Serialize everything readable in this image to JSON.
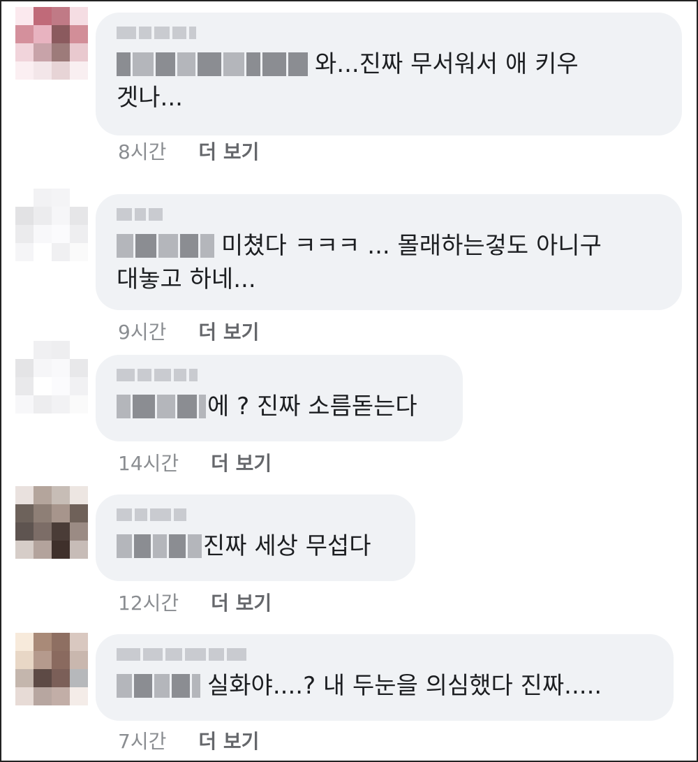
{
  "comments": [
    {
      "line1": "와...진짜 무서워서 애 키우",
      "line2": "겟나...",
      "time": "8시간",
      "more": "더 보기",
      "avatar_colors": [
        "#fbe9ee",
        "#c06a79",
        "#c07a86",
        "#f5dde3",
        "#d4909c",
        "#e8b3c0",
        "#8b5a5e",
        "#d28e98",
        "#f1d4db",
        "#c8a3a9",
        "#9d7b7a",
        "#e9c9cf",
        "#fbeff2",
        "#f3e6e9",
        "#e7d4d6",
        "#f9eff1"
      ]
    },
    {
      "line1": "미쳤다 ㅋㅋㅋ ... 몰래하는겋도 아니구",
      "line2": "대놓고 하네...",
      "time": "9시간",
      "more": "더 보기",
      "avatar_colors": [
        "#ffffff",
        "#f2f2f4",
        "#f4f4f6",
        "#ffffff",
        "#e2e2e4",
        "#ececee",
        "#f6f6f8",
        "#e6e6e8",
        "#ebebed",
        "#f8f8fa",
        "#fbfbfd",
        "#eeeef0",
        "#f5f5f7",
        "#ffffff",
        "#f0f0f2",
        "#fafafa"
      ]
    },
    {
      "line1": "에 ? 진짜 소름돋는다",
      "time": "14시간",
      "more": "더 보기",
      "avatar_colors": [
        "#ffffff",
        "#f0f0f2",
        "#eeeef0",
        "#ffffff",
        "#e4e4e6",
        "#f6f6f8",
        "#f9f9fb",
        "#e8e8ea",
        "#e9e9eb",
        "#ffffff",
        "#fbfbfd",
        "#f1f1f3",
        "#f7f7f9",
        "#ededef",
        "#f2f2f4",
        "#fafafa"
      ]
    },
    {
      "line1": "진짜 세상 무섭다",
      "time": "12시간",
      "more": "더 보기",
      "avatar_colors": [
        "#e9e1de",
        "#b4a59c",
        "#c7bdb6",
        "#ede6e2",
        "#6d625b",
        "#8e7f76",
        "#a7958c",
        "#6f6159",
        "#5e5450",
        "#7c6d67",
        "#4a3c37",
        "#9b8b84",
        "#d6cdc8",
        "#b3a39c",
        "#3f302b",
        "#c7bcb7"
      ]
    },
    {
      "line1": "실화야....? 내 두눈을 의심했다 진짜.....",
      "time": "7시간",
      "more": "더 보기",
      "avatar_colors": [
        "#f7eadb",
        "#a98a78",
        "#8e6f62",
        "#d9c8c0",
        "#e8d7c6",
        "#b59a8d",
        "#8a6a5f",
        "#c9b7ae",
        "#c4b6ad",
        "#5d4a45",
        "#7b5f58",
        "#b6b8bb",
        "#e7dbd6",
        "#b7a6a0",
        "#c2aea7",
        "#f4ece8"
      ]
    }
  ]
}
